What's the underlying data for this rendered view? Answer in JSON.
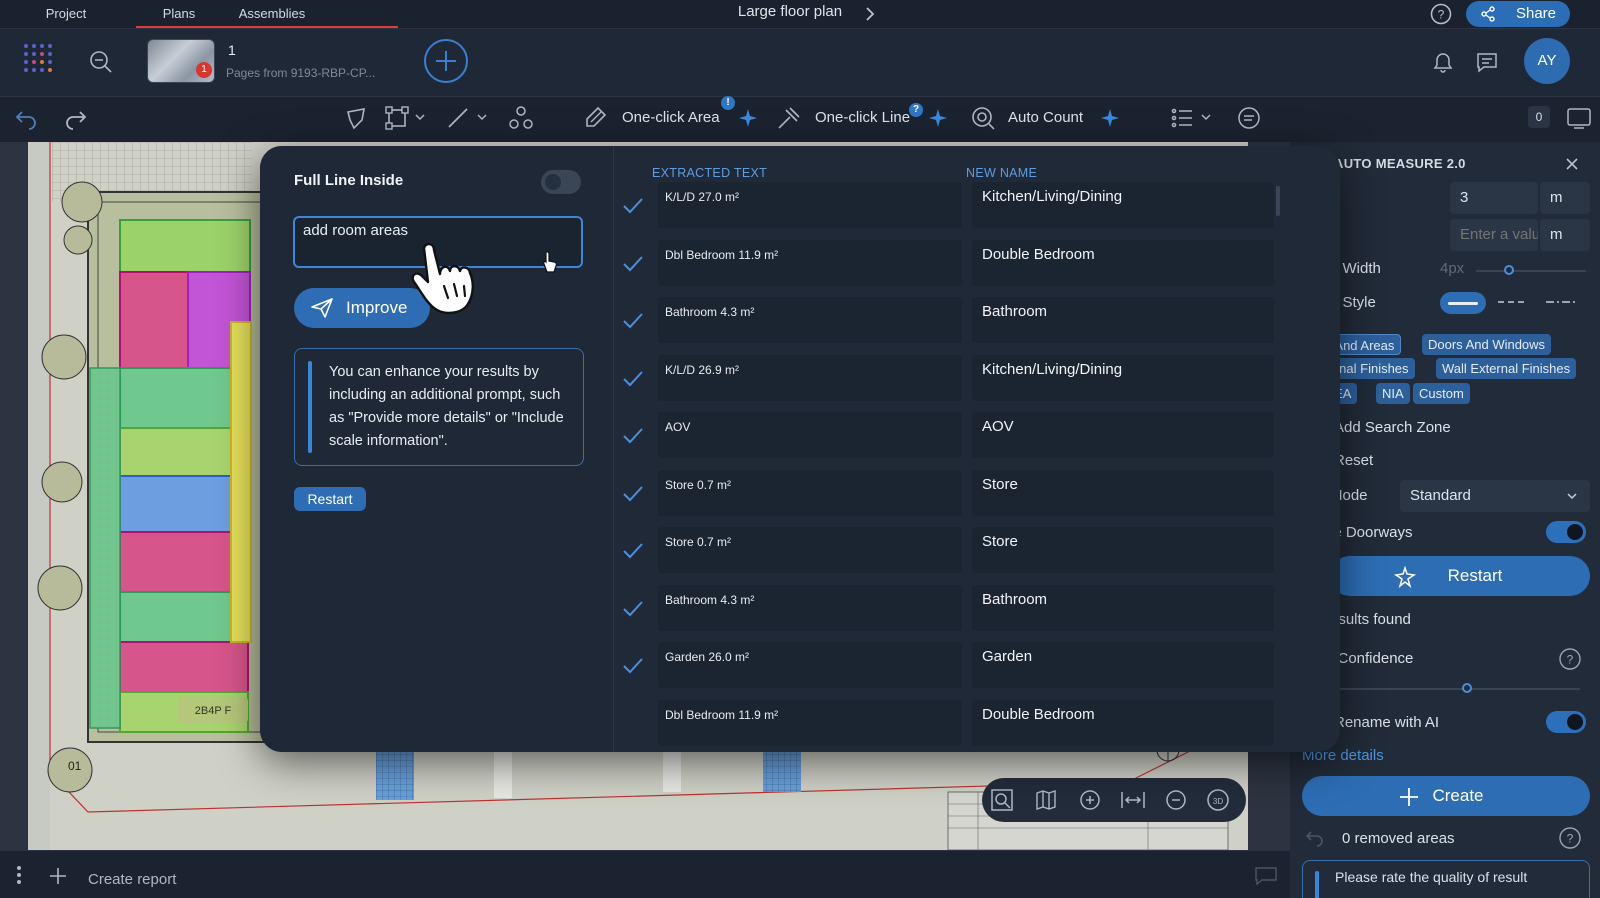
{
  "topbar": {
    "tabs": [
      {
        "label": "Project"
      },
      {
        "label": "Plans"
      },
      {
        "label": "Assemblies"
      }
    ],
    "doc_title": "Large floor plan",
    "share_label": "Share"
  },
  "plan": {
    "number": "1",
    "subtitle": "Pages from 9193-RBP-CP...",
    "badge": "1"
  },
  "user": {
    "initials": "AY"
  },
  "toolbar": {
    "one_click_area": "One-click Area",
    "one_click_line": "One-click Line",
    "auto_count": "Auto Count",
    "count_badge": "0",
    "area_badge": "!",
    "line_badge": "?"
  },
  "modal": {
    "full_line_inside_label": "Full Line Inside",
    "prompt_value": "add room areas",
    "improve_label": "Improve",
    "tip_text": "You can enhance your results by including an additional prompt, such as \"Provide more details\" or \"Include scale information\".",
    "restart_label": "Restart",
    "col_extracted": "EXTRACTED TEXT",
    "col_new_name": "NEW NAME",
    "rows": [
      {
        "extracted": "K/L/D 27.0 m²",
        "new_name": "Kitchen/Living/Dining"
      },
      {
        "extracted": "Dbl Bedroom 11.9 m²",
        "new_name": "Double Bedroom"
      },
      {
        "extracted": "Bathroom 4.3 m²",
        "new_name": "Bathroom"
      },
      {
        "extracted": "K/L/D 26.9 m²",
        "new_name": "Kitchen/Living/Dining"
      },
      {
        "extracted": "AOV",
        "new_name": "AOV"
      },
      {
        "extracted": "Store 0.7 m²",
        "new_name": "Store"
      },
      {
        "extracted": "Store 0.7 m²",
        "new_name": "Store"
      },
      {
        "extracted": "Bathroom 4.3 m²",
        "new_name": "Bathroom"
      },
      {
        "extracted": "Garden 26.0 m²",
        "new_name": "Garden"
      },
      {
        "extracted": "Dbl Bedroom 11.9 m²",
        "new_name": "Double Bedroom"
      }
    ]
  },
  "right_panel": {
    "title": "AUTO MEASURE 2.0",
    "row1_label": "t",
    "row1_value": "3",
    "row1_unit": "m",
    "row2_label": "t",
    "row2_placeholder": "Enter a valu",
    "row2_unit": "m",
    "line_width_label": "e Width",
    "line_width_value": "4px",
    "line_style_label": "e Style",
    "chips": [
      "s And Areas",
      "Doors And Windows",
      "ternal Finishes",
      "Wall External Finishes",
      "GEA",
      "NIA",
      "Custom"
    ],
    "add_search_zone": "Add Search Zone",
    "reset": "Reset",
    "mode_label": "Mode",
    "mode_value": "Standard",
    "doorways_label": "le Doorways",
    "restart_label": "Restart",
    "results_found": "esults found",
    "confidence_label": "l Confidence",
    "rename_ai_label": "Rename with AI",
    "more_details": "More details",
    "create_label": "Create",
    "removed_areas": "0 removed areas",
    "rate_quality": "Please rate the quality of result"
  },
  "plan_labels": {
    "unit_label": "2B4P F",
    "level_label": "01"
  },
  "bottom": {
    "create_report": "Create report"
  }
}
